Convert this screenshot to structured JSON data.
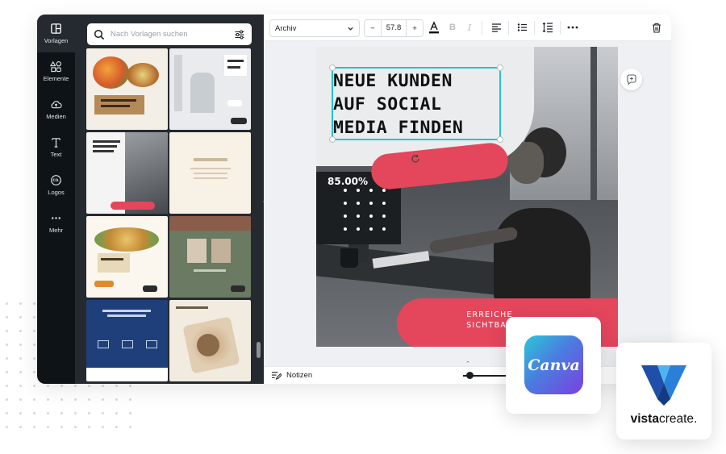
{
  "rail": {
    "items": [
      {
        "label": "Vorlagen",
        "icon": "templates-icon"
      },
      {
        "label": "Elemente",
        "icon": "elements-icon"
      },
      {
        "label": "Medien",
        "icon": "upload-cloud-icon"
      },
      {
        "label": "Text",
        "icon": "text-icon"
      },
      {
        "label": "Logos",
        "icon": "logos-icon"
      },
      {
        "label": "Mehr",
        "icon": "more-dots-icon"
      }
    ]
  },
  "panel": {
    "search_placeholder": "Nach Vorlagen suchen"
  },
  "toolbar": {
    "font_name": "Archiv",
    "font_size": "57.8",
    "minus": "−",
    "plus": "+"
  },
  "design": {
    "headline_lines": [
      "NEUE KUNDEN",
      "AUF SOCIAL",
      "MEDIA FINDEN"
    ],
    "percentage": "85.00%",
    "cta_lines": [
      "ERREICHE",
      "SICHTBAR"
    ]
  },
  "bottom": {
    "notes_label": "Notizen"
  },
  "brands": {
    "canva": "Canva",
    "vista_bold": "vista",
    "vista_regular": "create",
    "vista_suffix": "."
  },
  "colors": {
    "accent_teal": "#23c4cf",
    "cta_pink": "#e4465c",
    "rail_bg": "#0e1318",
    "panel_bg": "#252a31"
  }
}
